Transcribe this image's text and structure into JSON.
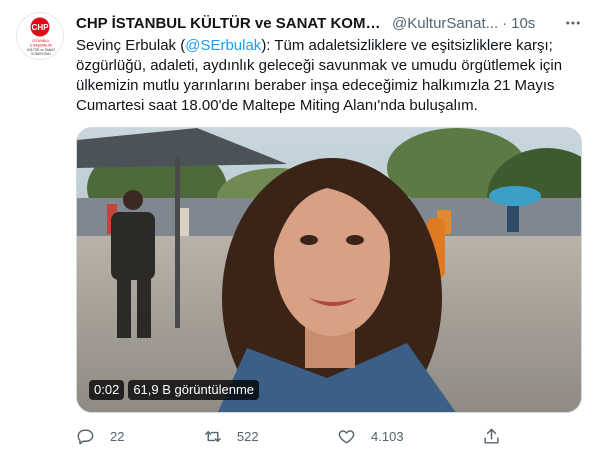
{
  "account": {
    "display_name": "CHP İSTANBUL KÜLTÜR ve SANAT KOMİS...",
    "handle": "@KulturSanat...",
    "separator": "·",
    "timestamp": "10s",
    "avatar_logo_text": "CHP",
    "avatar_caption_lines": [
      "İSTANBUL",
      "İL BAŞKANLIĞI",
      "KÜLTÜR ve SANAT",
      "KOMİSYONU"
    ]
  },
  "tweet": {
    "text_before": "Sevinç Erbulak (",
    "mention": "@SErbulak",
    "text_after": "): Tüm adaletsizliklere ve eşitsizliklere karşı; özgürlüğü, adaleti, aydınlık geleceği savunmak ve umudu örgütlemek için ülkemizin mutlu yarınlarını beraber inşa edeceğimiz halkımızla 21 Mayıs Cumartesi saat 18.00'de Maltepe Miting Alanı'nda buluşalım."
  },
  "video": {
    "duration": "0:02",
    "views": "61,9 B görüntülenme"
  },
  "actions": {
    "reply_count": "22",
    "retweet_count": "522",
    "like_count": "4.103"
  },
  "colors": {
    "text": "#0f1419",
    "secondary": "#536471",
    "link": "#1d9bf0",
    "brand_red": "#e30a17"
  },
  "icons": {
    "more": "more-icon",
    "reply": "reply-icon",
    "retweet": "retweet-icon",
    "like": "like-icon",
    "share": "share-icon"
  }
}
